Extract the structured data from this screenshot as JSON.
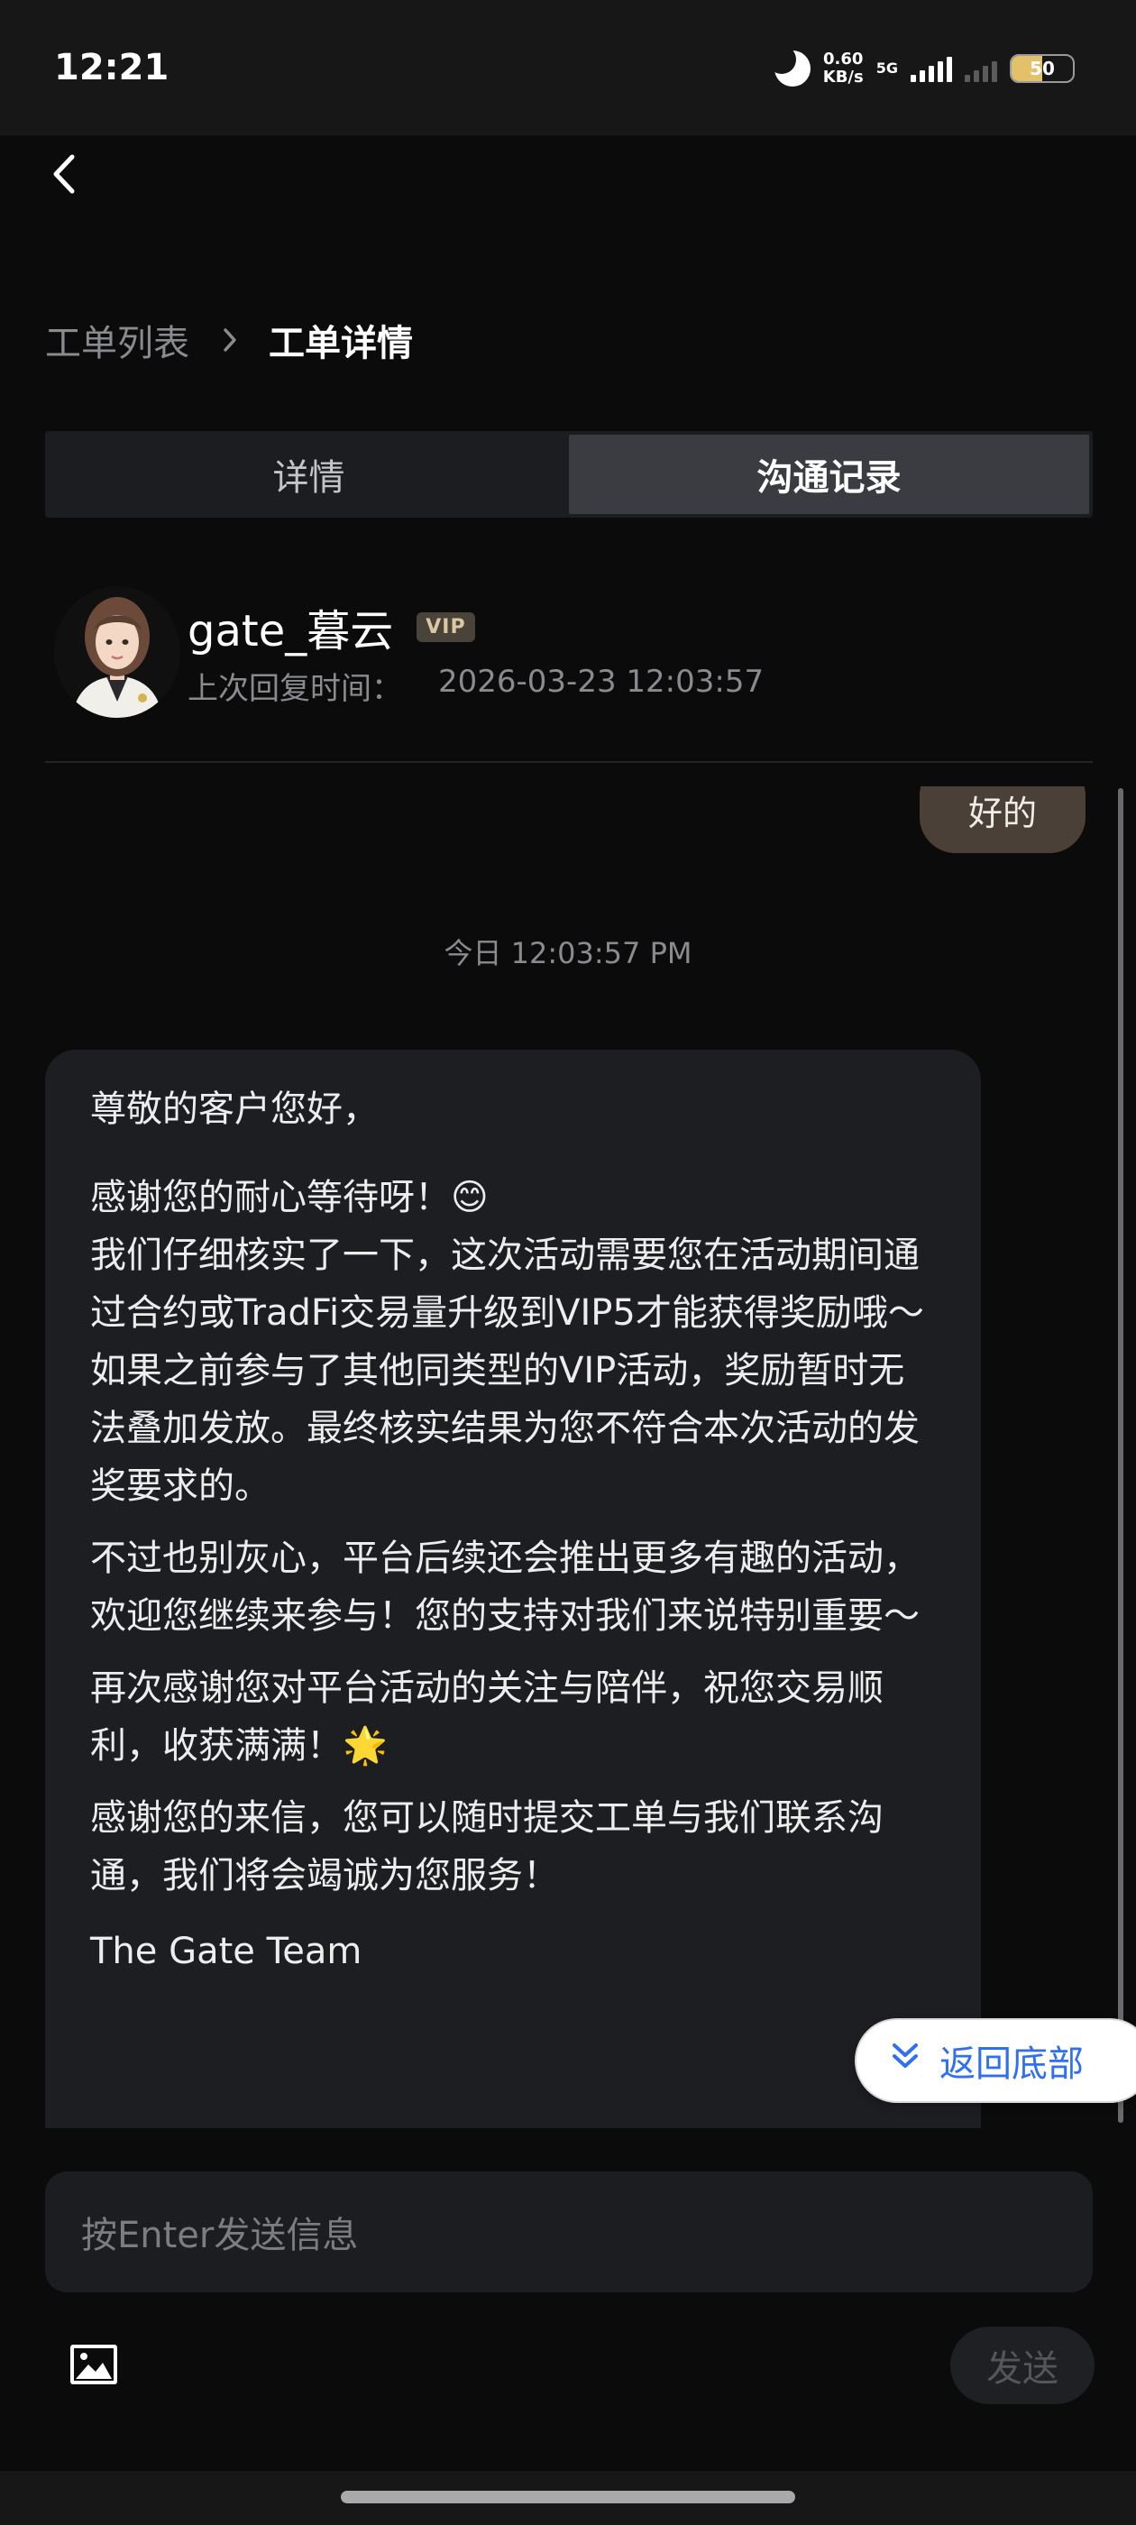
{
  "status": {
    "time": "12:21",
    "speed_value": "0.60",
    "speed_unit": "KB/s",
    "network": "5G",
    "battery": "50"
  },
  "breadcrumb": {
    "list": "工单列表",
    "current": "工单详情"
  },
  "tabs": [
    {
      "label": "详情",
      "active": false
    },
    {
      "label": "沟通记录",
      "active": true
    }
  ],
  "agent": {
    "name": "gate_暮云",
    "badge": "VIP",
    "last_reply_label": "上次回复时间：",
    "last_reply_time": "2026-03-23 12:03:57"
  },
  "chat": {
    "user_message": "好的",
    "timestamp": "今日 12:03:57 PM",
    "agent_message": {
      "greeting": "尊敬的客户您好，",
      "thanks": "感谢您的耐心等待呀！😊",
      "body1": "我们仔细核实了一下，这次活动需要您在活动期间通过合约或TradFi交易量升级到VIP5才能获得奖励哦～如果之前参与了其他同类型的VIP活动，奖励暂时无法叠加发放。最终核实结果为您不符合本次活动的发奖要求的。",
      "body2": "不过也别灰心，平台后续还会推出更多有趣的活动，欢迎您继续来参与！您的支持对我们来说特别重要～",
      "body3": "再次感谢您对平台活动的关注与陪伴，祝您交易顺利，收获满满！🌟",
      "body4": "感谢您的来信，您可以随时提交工单与我们联系沟通，我们将会竭诚为您服务！",
      "signature": "The Gate Team"
    }
  },
  "scroll_to_bottom_label": "返回底部",
  "composer": {
    "placeholder": "按Enter发送信息",
    "send_label": "发送"
  },
  "colors": {
    "accent": "#2f6ff2",
    "user_bubble": "#4a4038",
    "agent_bubble": "#1d1e21",
    "vip_gold": "#d9c8a3"
  }
}
